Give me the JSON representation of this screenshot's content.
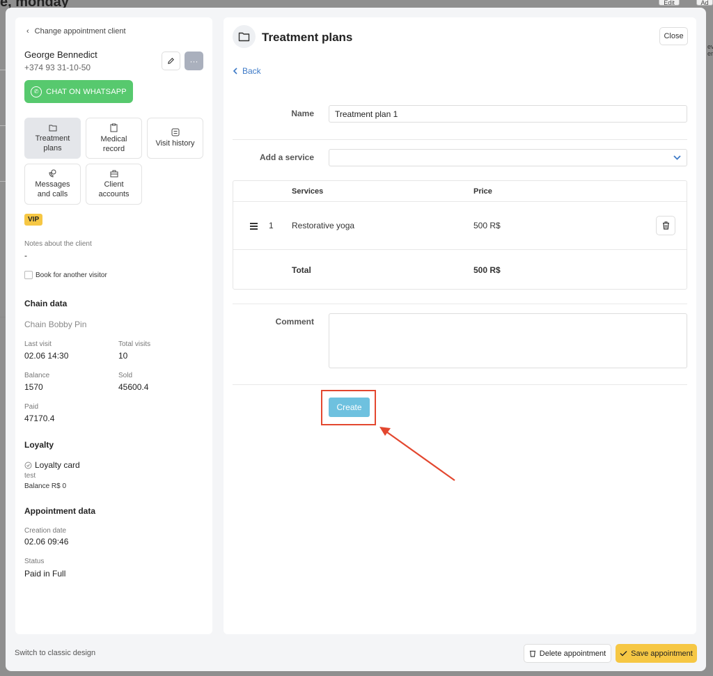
{
  "backdrop": {
    "title": "e, monday",
    "button_1": "Edit",
    "button_2": "Ad",
    "side_text": "ev er"
  },
  "client_panel": {
    "back_link": "Change appointment client",
    "name": "George Bennedict",
    "phone": "+374 93 31-10-50",
    "more_label": "···",
    "whatsapp_label": "CHAT ON WHATSAPP",
    "tiles": [
      {
        "label": "Treatment plans",
        "icon": "folder-icon"
      },
      {
        "label": "Medical record",
        "icon": "clipboard-icon"
      },
      {
        "label": "Visit history",
        "icon": "history-icon"
      },
      {
        "label": "Messages and calls",
        "icon": "chat-phone-icon"
      },
      {
        "label": "Client accounts",
        "icon": "briefcase-icon"
      }
    ],
    "tile_lines": {
      "t0_l1": "Treatment",
      "t0_l2": "plans",
      "t1_l1": "Medical",
      "t1_l2": "record",
      "t2_l1": "Visit history",
      "t3_l1": "Messages",
      "t3_l2": "and calls",
      "t4_l1": "Client",
      "t4_l2": "accounts"
    },
    "vip_badge": "VIP",
    "notes_label": "Notes about the client",
    "notes_value": "-",
    "book_other_label": "Book for another visitor",
    "chain_heading": "Chain data",
    "chain_name": "Chain Bobby Pin",
    "stats": {
      "last_visit_label": "Last visit",
      "last_visit_value": "02.06 14:30",
      "total_visits_label": "Total visits",
      "total_visits_value": "10",
      "balance_label": "Balance",
      "balance_value": "1570",
      "sold_label": "Sold",
      "sold_value": "45600.4",
      "paid_label": "Paid",
      "paid_value": "47170.4"
    },
    "loyalty_heading": "Loyalty",
    "loyalty_card": "Loyalty card",
    "loyalty_sub": "test",
    "loyalty_balance": "Balance R$ 0",
    "appointment_heading": "Appointment data",
    "creation_label": "Creation date",
    "creation_value": "02.06 09:46",
    "status_label": "Status",
    "status_value": "Paid in Full"
  },
  "treatment_panel": {
    "title": "Treatment plans",
    "close_label": "Close",
    "back_label": "Back",
    "name_label": "Name",
    "name_value": "Treatment plan 1",
    "service_label": "Add a service",
    "service_value": "",
    "table": {
      "col_services": "Services",
      "col_price": "Price",
      "rows": [
        {
          "index": "1",
          "service": "Restorative yoga",
          "price": "500 R$"
        }
      ],
      "total_label": "Total",
      "total_value": "500 R$"
    },
    "comment_label": "Comment",
    "comment_value": "",
    "create_label": "Create"
  },
  "footer": {
    "switch_label": "Switch to classic design",
    "delete_label": "Delete appointment",
    "save_label": "Save appointment"
  },
  "colors": {
    "accent_blue": "#3d7ac7",
    "whatsapp_green": "#57c96e",
    "vip_yellow": "#f6c744",
    "create_blue": "#6ec1df",
    "highlight_red": "#e3472f"
  }
}
